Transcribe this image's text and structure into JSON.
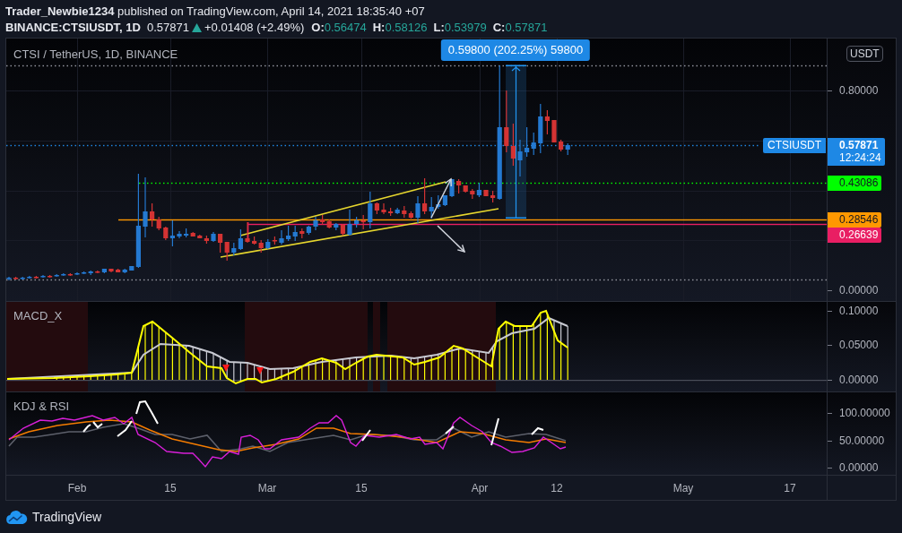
{
  "header": {
    "text": "**Trader_Newbie1234** published on TradingView.com, April 14, 2021 18:35:40 +07"
  },
  "symbol_bar": {
    "symbol": "BINANCE:CTSIUSDT, 1D",
    "last": "0.57871",
    "rising": true,
    "change": "+0.01408 (+2.49%)",
    "ohlc": [
      {
        "key": "O:",
        "value": "0.56474"
      },
      {
        "key": "H:",
        "value": "0.58126"
      },
      {
        "key": "L:",
        "value": "0.53979"
      },
      {
        "key": "C:",
        "value": "0.57871"
      }
    ]
  },
  "main_pane": {
    "legend": "CTSI / TetherUS, 1D, BINANCE",
    "measure": {
      "label": "0.59800 (202.25%) 59800"
    },
    "price_axis": {
      "currency": "USDT",
      "ticks": [
        "0.80000",
        "0.00000"
      ]
    },
    "price_tags": [
      {
        "kind": "last_price",
        "symbol": "CTSIUSDT",
        "price": "0.57871",
        "countdown": "12:24:24",
        "color": "#1e88e5",
        "dotted": true
      },
      {
        "kind": "line",
        "price": "0.43086",
        "color": "#00ff00",
        "dotted": true
      },
      {
        "kind": "line",
        "price": "0.28546",
        "color": "#ff9800",
        "dotted": false
      },
      {
        "kind": "line",
        "price": "0.26639",
        "color": "#e91e63",
        "dotted": false
      }
    ]
  },
  "macd_pane": {
    "title": "MACD_X",
    "ticks": [
      "0.10000",
      "0.05000",
      "0.00000"
    ]
  },
  "kdj_pane": {
    "title": "KDJ & RSI",
    "ticks": [
      "100.00000",
      "50.00000",
      "0.00000"
    ]
  },
  "time_axis": {
    "labels": [
      "Feb",
      "15",
      "Mar",
      "15",
      "Apr",
      "12",
      "May",
      "17"
    ]
  },
  "footer": {
    "brand": "TradingView"
  }
}
